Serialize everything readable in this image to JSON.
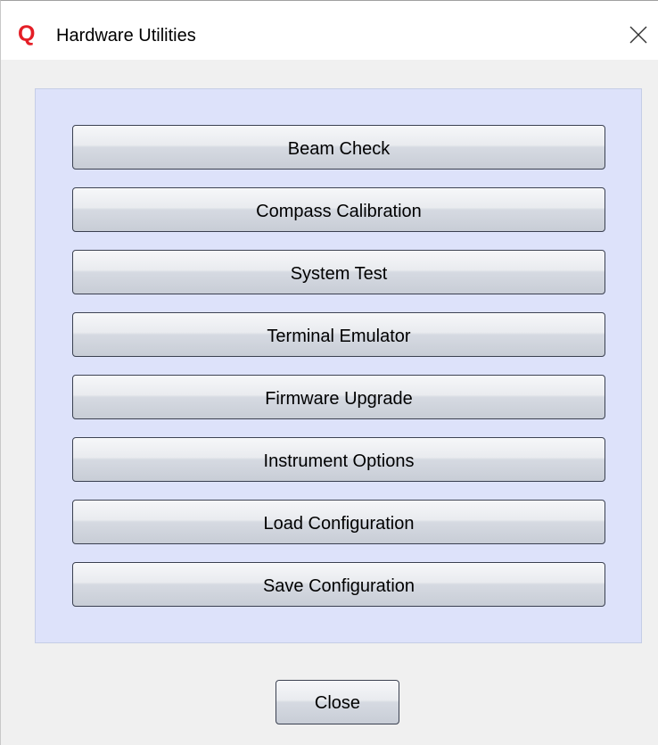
{
  "window": {
    "logo_letter": "Q",
    "title": "Hardware Utilities",
    "close_icon": "close-icon",
    "accent_color": "#e41e26"
  },
  "utilities": {
    "beam_check": "Beam Check",
    "compass_calibration": "Compass Calibration",
    "system_test": "System Test",
    "terminal_emulator": "Terminal Emulator",
    "firmware_upgrade": "Firmware Upgrade",
    "instrument_options": "Instrument Options",
    "load_configuration": "Load Configuration",
    "save_configuration": "Save Configuration"
  },
  "footer": {
    "close_label": "Close"
  }
}
